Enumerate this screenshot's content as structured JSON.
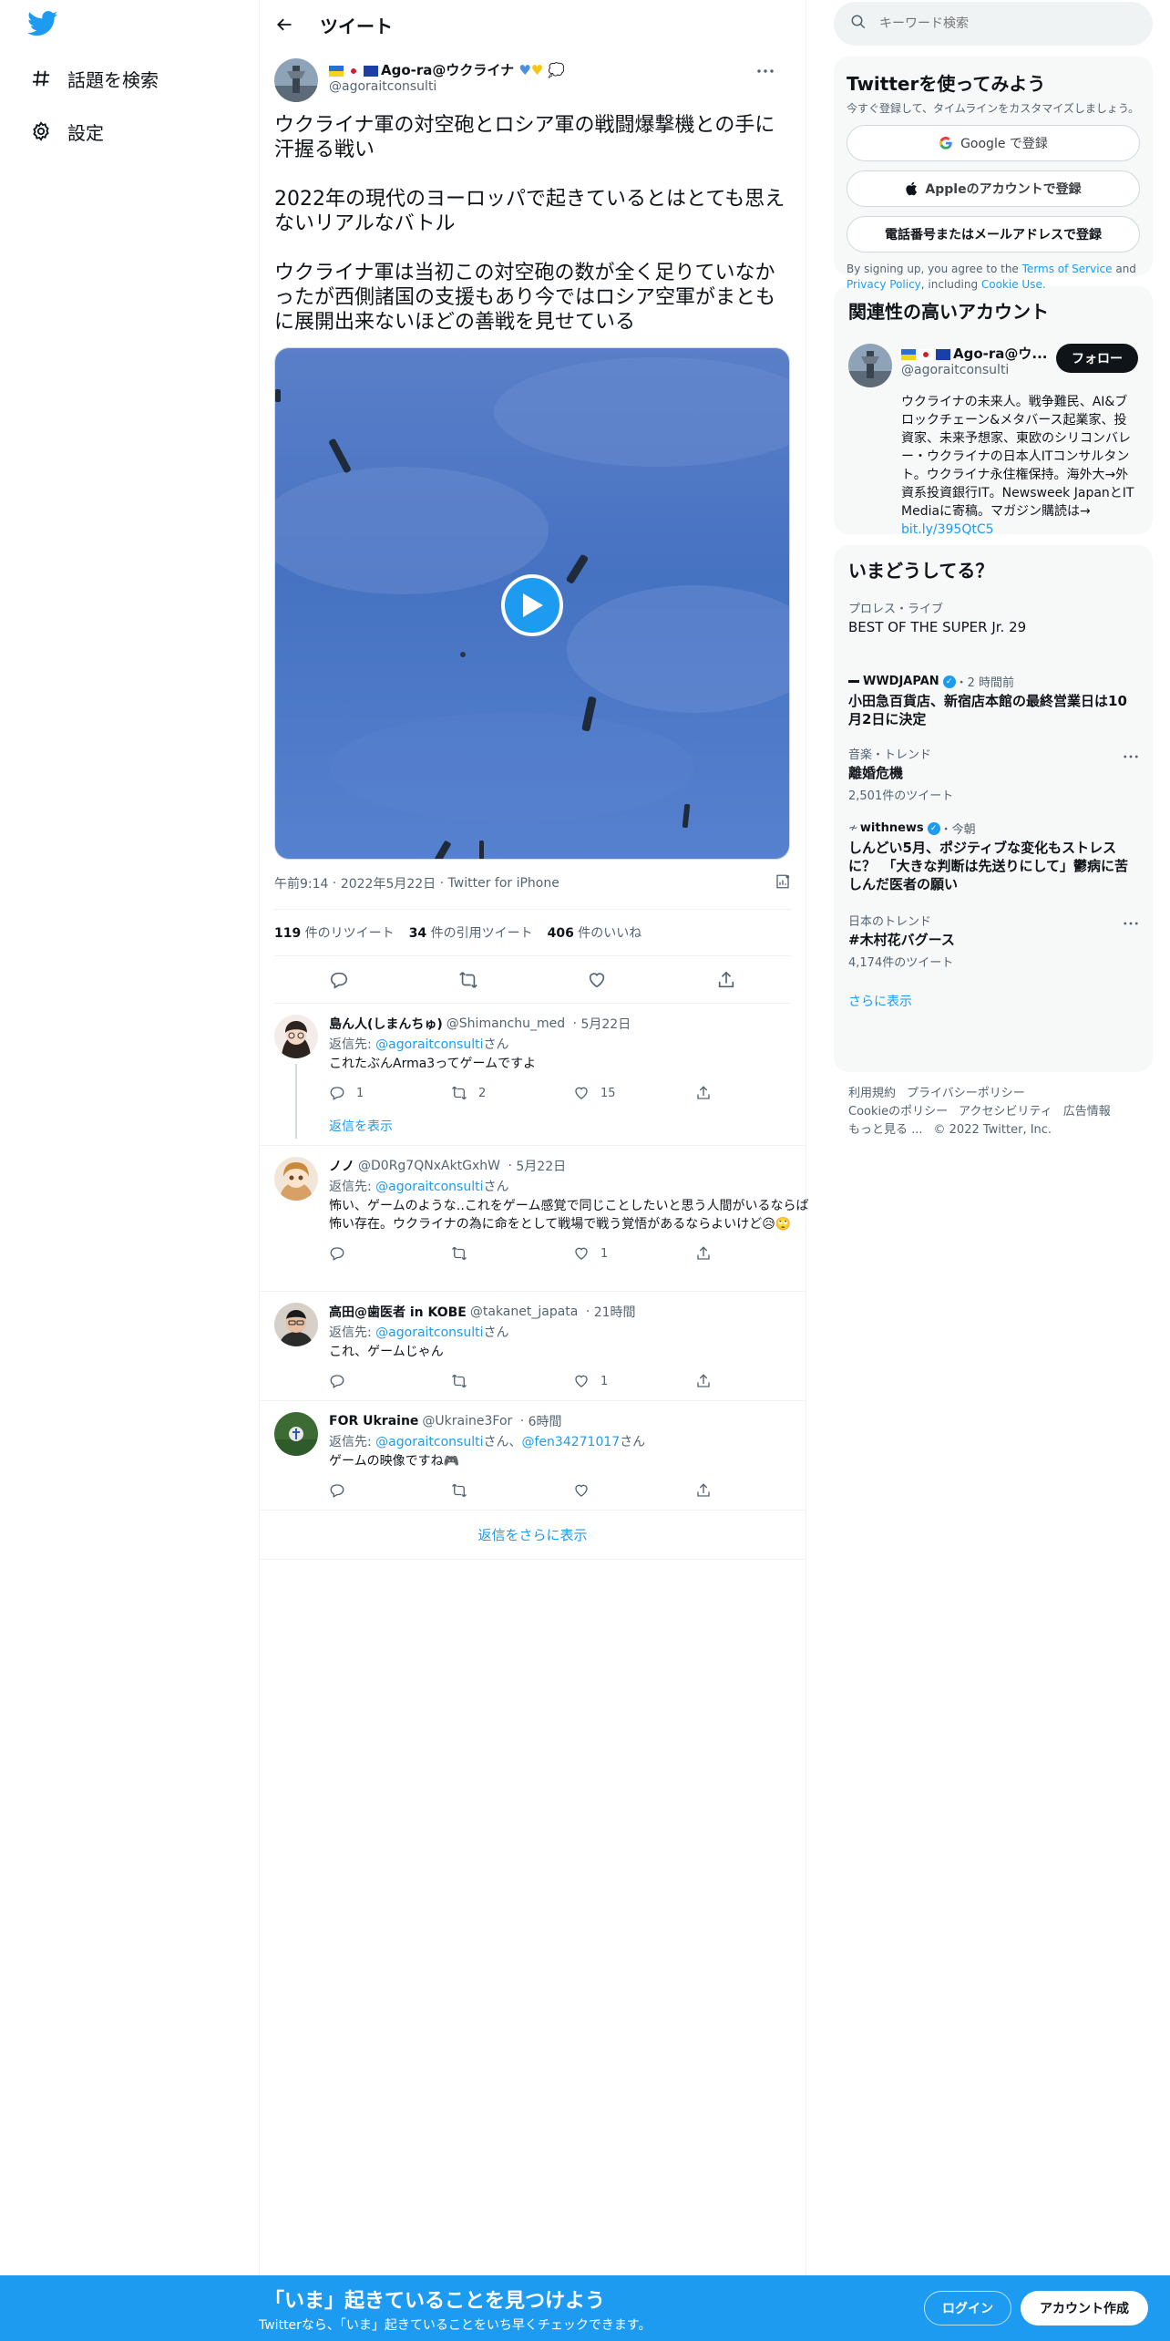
{
  "nav": {
    "explore_label": "話題を検索",
    "settings_label": "設定"
  },
  "header": {
    "title": "ツイート"
  },
  "tweet": {
    "display_name": "Ago-ra@ウクライナ",
    "handle": "@agoraitconsulti",
    "paragraphs": [
      "ウクライナ軍の対空砲とロシア軍の戦闘爆撃機との手に汗握る戦い",
      "2022年の現代のヨーロッパで起きているとはとても思えないリアルなバトル",
      "ウクライナ軍は当初この対空砲の数が全く足りていなかったが西側諸国の支援もあり今ではロシア空軍がまともに展開出来ないほどの善戦を見せている"
    ],
    "time": "午前9:14",
    "date": "2022年5月22日",
    "source": "Twitter for iPhone",
    "retweets": "119",
    "retweets_label": " 件のリツイート",
    "quotes": "34",
    "quotes_label": " 件の引用ツイート",
    "likes": "406",
    "likes_label": " 件のいいね"
  },
  "replies": [
    {
      "display_name": "島ん人(しまんちゅ)",
      "handle": "@Shimanchu_med",
      "time": "5月22日",
      "replyto_prefix": "返信先: ",
      "replyto_user": "@agoraitconsulti",
      "replyto_suffix": "さん",
      "text": "これたぶんArma3ってゲームですよ",
      "reply_count": "1",
      "retweet_count": "2",
      "like_count": "15",
      "show_replies": "返信を表示"
    },
    {
      "display_name": "ノノ",
      "handle": "@D0Rg7QNxAktGxhW",
      "time": "5月22日",
      "replyto_prefix": "返信先: ",
      "replyto_user": "@agoraitconsulti",
      "replyto_suffix": "さん",
      "text": "怖い、ゲームのような‥これをゲーム感覚で同じことしたいと思う人間がいるならば怖い存在。ウクライナの為に命をとして戦場で戦う覚悟があるならよいけど😥🙄",
      "reply_count": "",
      "retweet_count": "",
      "like_count": "1"
    },
    {
      "display_name": "高田@歯医者 in KOBE",
      "handle": "@takanet_japata",
      "time": "21時間",
      "replyto_prefix": "返信先: ",
      "replyto_user": "@agoraitconsulti",
      "replyto_suffix": "さん",
      "text": "これ、ゲームじゃん",
      "reply_count": "",
      "retweet_count": "",
      "like_count": "1"
    },
    {
      "display_name": "FOR Ukraine",
      "handle": "@Ukraine3For",
      "time": "6時間",
      "replyto_prefix": "返信先: ",
      "replyto_user": "@agoraitconsulti",
      "replyto_mid": "さん、",
      "replyto_user2": "@fen34271017",
      "replyto_suffix": "さん",
      "text": "ゲームの映像ですね🎮",
      "reply_count": "",
      "retweet_count": "",
      "like_count": ""
    }
  ],
  "more_replies": "返信をさらに表示",
  "search": {
    "placeholder": "キーワード検索"
  },
  "signup_card": {
    "title": "Twitterを使ってみよう",
    "subtitle": "今すぐ登録して、タイムラインをカスタマイズしましょう。",
    "google": "Google で登録",
    "apple": "Appleのアカウントで登録",
    "phone": "電話番号またはメールアドレスで登録",
    "legal_prefix": "By signing up, you agree to the ",
    "terms": "Terms of Service",
    "and": " and ",
    "privacy": "Privacy Policy",
    "including": ", including ",
    "cookie": "Cookie Use."
  },
  "related": {
    "title": "関連性の高いアカウント",
    "display_name": "Ago-ra@ウ...",
    "handle": "@agoraitconsulti",
    "follow": "フォロー",
    "bio": "ウクライナの未来人。戦争難民、AI&ブロックチェーン&メタバース起業家、投資家、未来予想家、東欧のシリコンバレー・ウクライナの日本人ITコンサルタント。ウクライナ永住権保持。海外大→外資系投資銀行IT。Newsweek JapanとIT Mediaに寄稿。マガジン購読は→ ",
    "bio_link": "bit.ly/395QtC5"
  },
  "trends": {
    "title": "いまどうしてる？",
    "items": [
      {
        "context": "プロレス・ライブ",
        "title": "BEST OF THE SUPER Jr. 29"
      },
      {
        "context": "WWDJAPAN",
        "context_time": "・2 時間前",
        "title": "小田急百貨店、新宿店本館の最終営業日は10月2日に決定"
      },
      {
        "context": "音楽・トレンド",
        "title": "離婚危機",
        "count": "2,501件のツイート"
      },
      {
        "context": "withnews",
        "context_time": "・今朝",
        "title": "しんどい5月、ポジティブな変化もストレスに？　「大きな判断は先送りにして」鬱病に苦しんだ医者の願い"
      },
      {
        "context": "日本のトレンド",
        "title": "#木村花バグース",
        "count": "4,174件のツイート"
      }
    ],
    "show_more": "さらに表示"
  },
  "footer": {
    "links": [
      "利用規約",
      "プライバシーポリシー",
      "Cookieのポリシー",
      "アクセシビリティ",
      "広告情報",
      "もっと見る ...",
      "© 2022 Twitter, Inc."
    ]
  },
  "bottombar": {
    "title": "「いま」起きていることを見つけよう",
    "subtitle": "Twitterなら、「いま」起きていることをいち早くチェックできます。",
    "login": "ログイン",
    "signup": "アカウント作成"
  },
  "colors": {
    "accent": "#1d9bf0",
    "text": "#0f1419",
    "muted": "#536471",
    "video_sky": "#4a78c4"
  }
}
